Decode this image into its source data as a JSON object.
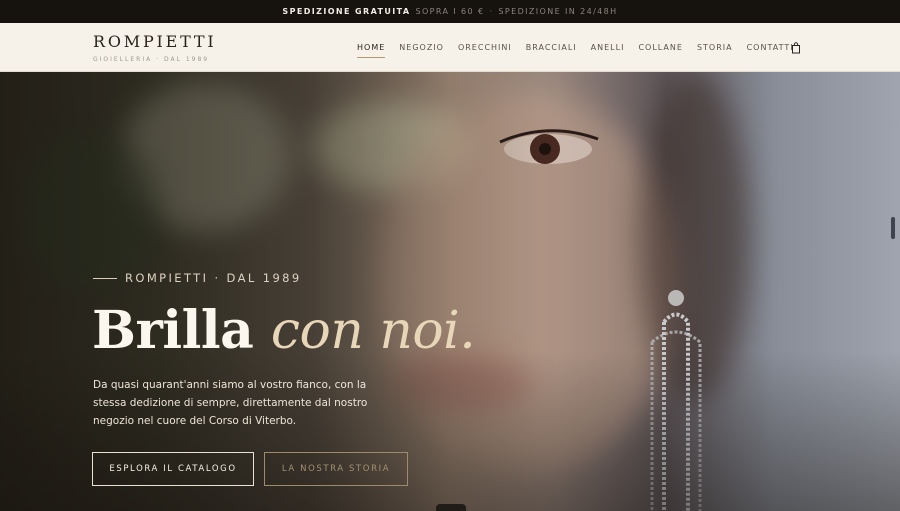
{
  "promo": {
    "strong": "SPEDIZIONE GRATUITA",
    "text": "SOPRA I 60 €",
    "separator": "·",
    "text2": "SPEDIZIONE IN 24/48H"
  },
  "header": {
    "logo_name": "ROMPIETTI",
    "logo_sub": "GIOIELLERIA · DAL 1989",
    "nav": [
      "HOME",
      "NEGOZIO",
      "ORECCHINI",
      "BRACCIALI",
      "ANELLI",
      "COLLANE",
      "STORIA",
      "CONTATTI"
    ],
    "active_nav": "HOME",
    "cart_icon": "shopping-bag-icon"
  },
  "hero": {
    "eyebrow": "ROMPIETTI · DAL 1989",
    "headline_plain": "Brilla",
    "headline_italic": "con noi.",
    "lead": "Da quasi quarant'anni siamo al vostro fianco, con la stessa dedizione di sempre, direttamente dal nostro negozio nel cuore del Corso di Viterbo.",
    "primary_button": "ESPLORA IL CATALOGO",
    "secondary_button": "LA NOSTRA STORIA"
  },
  "colors": {
    "accent": "#b59a76",
    "header_bg": "#f6f2ea",
    "promo_bg": "#16120e",
    "headline_italic": "#e8d6b8"
  }
}
